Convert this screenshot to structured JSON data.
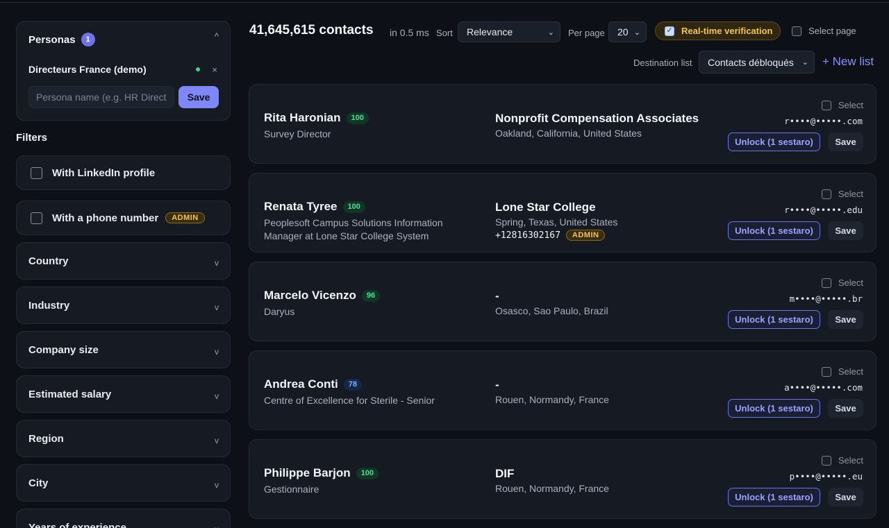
{
  "sidebar": {
    "personas": {
      "title": "Personas",
      "count": "1",
      "collapse_glyph": "^",
      "active_persona": "Directeurs France (demo)",
      "remove_glyph": "×",
      "input_placeholder": "Persona name (e.g. HR Direct",
      "save_label": "Save"
    },
    "filters_title": "Filters",
    "checkbox_filters": [
      {
        "label": "With LinkedIn profile",
        "badge": ""
      },
      {
        "label": "With a phone number",
        "badge": "ADMIN"
      }
    ],
    "dropdown_filters": [
      "Country",
      "Industry",
      "Company size",
      "Estimated salary",
      "Region",
      "City",
      "Years of experience"
    ],
    "dropdown_glyph": "v"
  },
  "toolbar": {
    "count": "41,645,615 contacts",
    "time": "in 0.5 ms",
    "sort_label": "Sort",
    "sort_value": "Relevance",
    "per_page_label": "Per page",
    "per_page_value": "20",
    "realtime_label": "Real-time verification",
    "realtime_checked": true,
    "select_page_label": "Select page",
    "destination_label": "Destination list",
    "destination_value": "Contacts débloqués",
    "new_list_label": "+ New list"
  },
  "contacts": [
    {
      "name": "Rita Haronian",
      "score": "100",
      "score_color": "green",
      "title": "Survey Director",
      "company": "Nonprofit Compensation Associates",
      "location": "Oakland, California, United States",
      "phone": "",
      "phone_badge": "",
      "email": "r••••@•••••.com",
      "select_label": "Select",
      "unlock_label": "Unlock (1 sestaro)",
      "save_label": "Save"
    },
    {
      "name": "Renata Tyree",
      "score": "100",
      "score_color": "green",
      "title": "Peoplesoft Campus Solutions Information Manager at Lone Star College System",
      "company": "Lone Star College",
      "location": "Spring, Texas, United States",
      "phone": "+12816302167",
      "phone_badge": "ADMIN",
      "email": "r••••@•••••.edu",
      "select_label": "Select",
      "unlock_label": "Unlock (1 sestaro)",
      "save_label": "Save"
    },
    {
      "name": "Marcelo Vicenzo",
      "score": "96",
      "score_color": "green",
      "title": "Daryus",
      "company": "-",
      "location": "Osasco, Sao Paulo, Brazil",
      "phone": "",
      "phone_badge": "",
      "email": "m••••@•••••.br",
      "select_label": "Select",
      "unlock_label": "Unlock (1 sestaro)",
      "save_label": "Save"
    },
    {
      "name": "Andrea Conti",
      "score": "78",
      "score_color": "blue",
      "title": "Centre of Excellence for Sterile - Senior",
      "company": "-",
      "location": "Rouen, Normandy, France",
      "phone": "",
      "phone_badge": "",
      "email": "a••••@•••••.com",
      "select_label": "Select",
      "unlock_label": "Unlock (1 sestaro)",
      "save_label": "Save"
    },
    {
      "name": "Philippe Barjon",
      "score": "100",
      "score_color": "green",
      "title": "Gestionnaire",
      "company": "DIF",
      "location": "Rouen, Normandy, France",
      "phone": "",
      "phone_badge": "",
      "email": "p••••@•••••.eu",
      "select_label": "Select",
      "unlock_label": "Unlock (1 sestaro)",
      "save_label": "Save"
    }
  ],
  "colors": {
    "background": "#0d1016",
    "card": "#151a23",
    "accent": "#7f86f5",
    "admin_badge": "#f2c54c",
    "score_green": "#4be095",
    "score_blue": "#7fb0ff"
  }
}
